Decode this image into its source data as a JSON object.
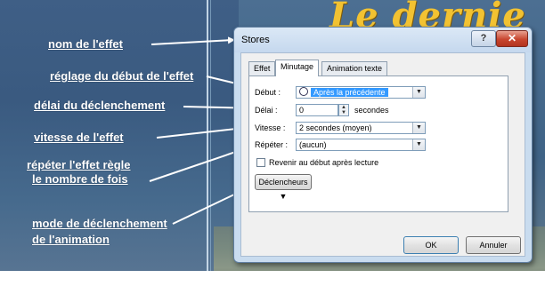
{
  "background": {
    "title_text": "Le dernie"
  },
  "annotations": [
    {
      "text": "nom de l'effet"
    },
    {
      "text": "réglage du début de l'effet"
    },
    {
      "text": "délai du déclenchement"
    },
    {
      "text": "vitesse de l'effet"
    },
    {
      "text": "répéter l'effet règle"
    },
    {
      "text": "le nombre de fois"
    },
    {
      "text": "mode de déclenchement"
    },
    {
      "text": "de l'animation"
    }
  ],
  "dialog": {
    "title": "Stores",
    "help_glyph": "?",
    "close_glyph": "✕",
    "tabs": [
      {
        "label": "Effet"
      },
      {
        "label": "Minutage"
      },
      {
        "label": "Animation texte"
      }
    ],
    "active_tab": "Minutage",
    "fields": {
      "debut": {
        "label": "Début :",
        "value": "Après la précédente"
      },
      "delai": {
        "label": "Délai :",
        "value": "0",
        "unit": "secondes"
      },
      "vitesse": {
        "label": "Vitesse :",
        "value": "2 secondes (moyen)"
      },
      "repeter": {
        "label": "Répéter :",
        "value": "(aucun)"
      }
    },
    "checkbox": {
      "label": "Revenir au début après lecture",
      "checked": false
    },
    "triggers_button": "Déclencheurs ▼",
    "ok_button": "OK",
    "cancel_button": "Annuler"
  },
  "colors": {
    "annotation_text": "#ffffff",
    "selection_highlight": "#3399ff",
    "close_button": "#c8462f",
    "title_gold": "#f2c232"
  },
  "icons": {
    "clock": "clock-icon",
    "dropdown": "chevron-down-icon",
    "spinner": "spinner-arrows-icon"
  }
}
